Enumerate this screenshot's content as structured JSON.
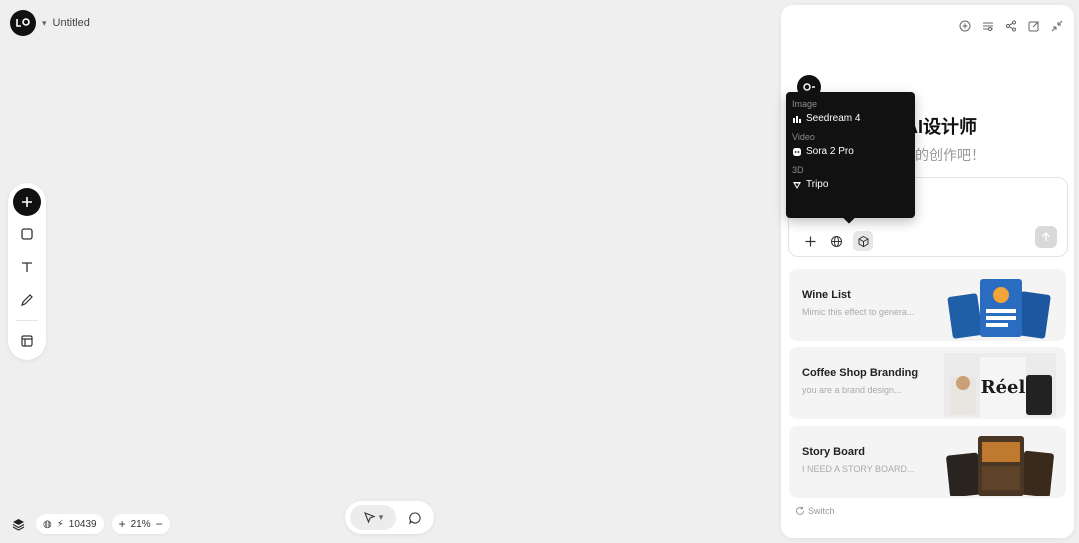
{
  "app": {
    "doc_title": "Untitled"
  },
  "toolbar": {
    "tools": [
      {
        "name": "add-tool",
        "icon": "plus-icon"
      },
      {
        "name": "rectangle-tool",
        "icon": "square-icon"
      },
      {
        "name": "text-tool",
        "icon": "text-icon"
      },
      {
        "name": "pen-tool",
        "icon": "pencil-icon"
      },
      {
        "name": "frame-tool",
        "icon": "layout-icon"
      }
    ]
  },
  "status": {
    "credits": "10439",
    "zoom": "21%"
  },
  "panel": {
    "welcome_title": "你的AI设计师",
    "welcome_sub": "的创作吧！",
    "input_placeholder": "",
    "cards": [
      {
        "title": "Wine List",
        "desc": "Mimic this effect to genera..."
      },
      {
        "title": "Coffee Shop Branding",
        "desc": "you are a brand design..."
      },
      {
        "title": "Story Board",
        "desc": "I NEED A STORY BOARD..."
      }
    ],
    "switch_label": "Switch"
  },
  "dropdown": {
    "sections": [
      {
        "label": "Image",
        "item": "Seedream 4"
      },
      {
        "label": "Video",
        "item": "Sora 2 Pro"
      },
      {
        "label": "3D",
        "item": "Tripo"
      }
    ]
  },
  "colors": {
    "bg": "#efefef",
    "dark": "#111111",
    "panel": "#ffffff"
  }
}
